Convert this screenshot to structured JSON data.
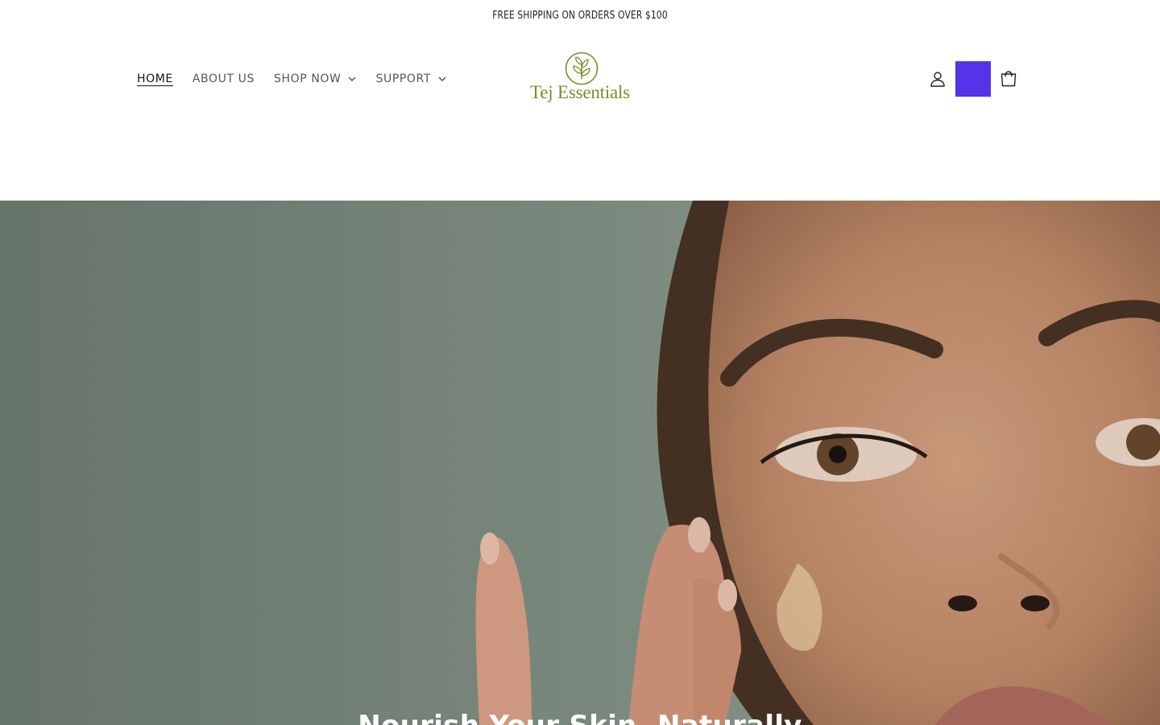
{
  "announcement": {
    "text": "FREE SHIPPING ON ORDERS OVER $100"
  },
  "nav": {
    "items": [
      {
        "label": "HOME",
        "active": true,
        "has_dropdown": false
      },
      {
        "label": "ABOUT US",
        "active": false,
        "has_dropdown": false
      },
      {
        "label": "SHOP NOW",
        "active": false,
        "has_dropdown": true
      },
      {
        "label": "SUPPORT",
        "active": false,
        "has_dropdown": true
      }
    ]
  },
  "logo": {
    "text": "Tej Essentials",
    "icon": "leaf-emblem-icon",
    "color": "#7f8a2a"
  },
  "utilities": {
    "account_icon": "user-icon",
    "cart_icon": "cart-icon",
    "accent_color": "#5533e8"
  },
  "hero": {
    "heading": "Nourish Your Skin, Naturally",
    "image": "woman applying serum to cheek"
  }
}
